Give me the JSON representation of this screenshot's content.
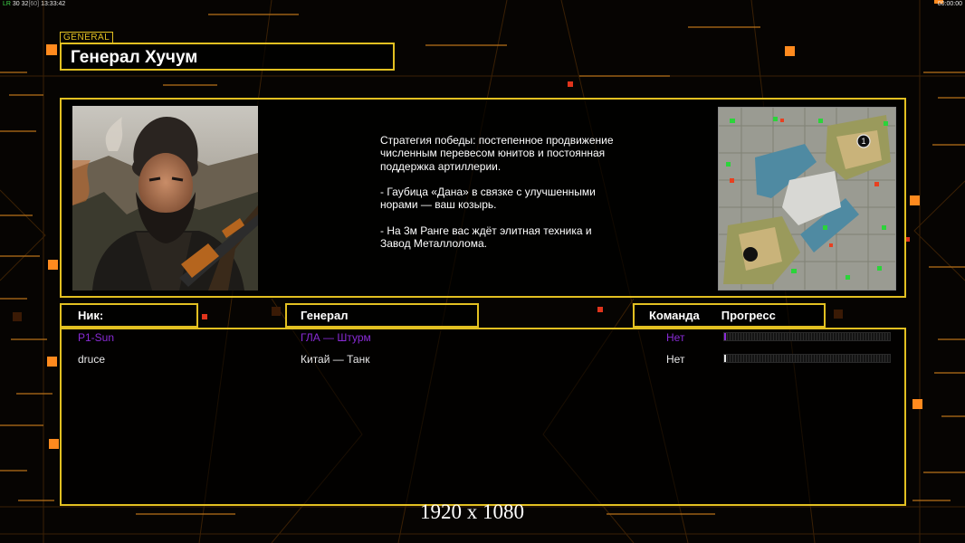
{
  "overlay": {
    "fps_prefix": "LR",
    "fps_values": "30 32",
    "fps_limit": "[60]",
    "time": "13:33:42",
    "clock": "00:00:00"
  },
  "general": {
    "tab_label": "GENERAL",
    "title": "Генерал Хучум",
    "portrait_icon": "general-portrait",
    "description": [
      "Стратегия победы: постепенное продвижение численным перевесом юнитов и постоянная поддержка артиллерии.",
      "- Гаубица «Дана» в связке с улучшенными норами — ваш козырь.",
      "- На 3м Ранге вас ждёт элитная техника и Завод Металлолома."
    ],
    "minimap_icon": "map-preview",
    "minimap_start_label": "1"
  },
  "columns": {
    "nick": "Ник:",
    "general": "Генерал",
    "team": "Команда",
    "progress": "Прогресс"
  },
  "players": [
    {
      "nick": "P1-Sun",
      "general": "ГЛА — Штурм",
      "team": "Нет",
      "progress": 0.01,
      "color": "#8a2bd6"
    },
    {
      "nick": "druce",
      "general": "Китай — Танк",
      "team": "Нет",
      "progress": 0.0,
      "color": "#e8e8e8"
    }
  ],
  "colors": {
    "accent": "#e2c021",
    "orange": "#ff8a1e",
    "red": "#e0341c"
  },
  "footer": {
    "resolution": "1920 x 1080"
  }
}
